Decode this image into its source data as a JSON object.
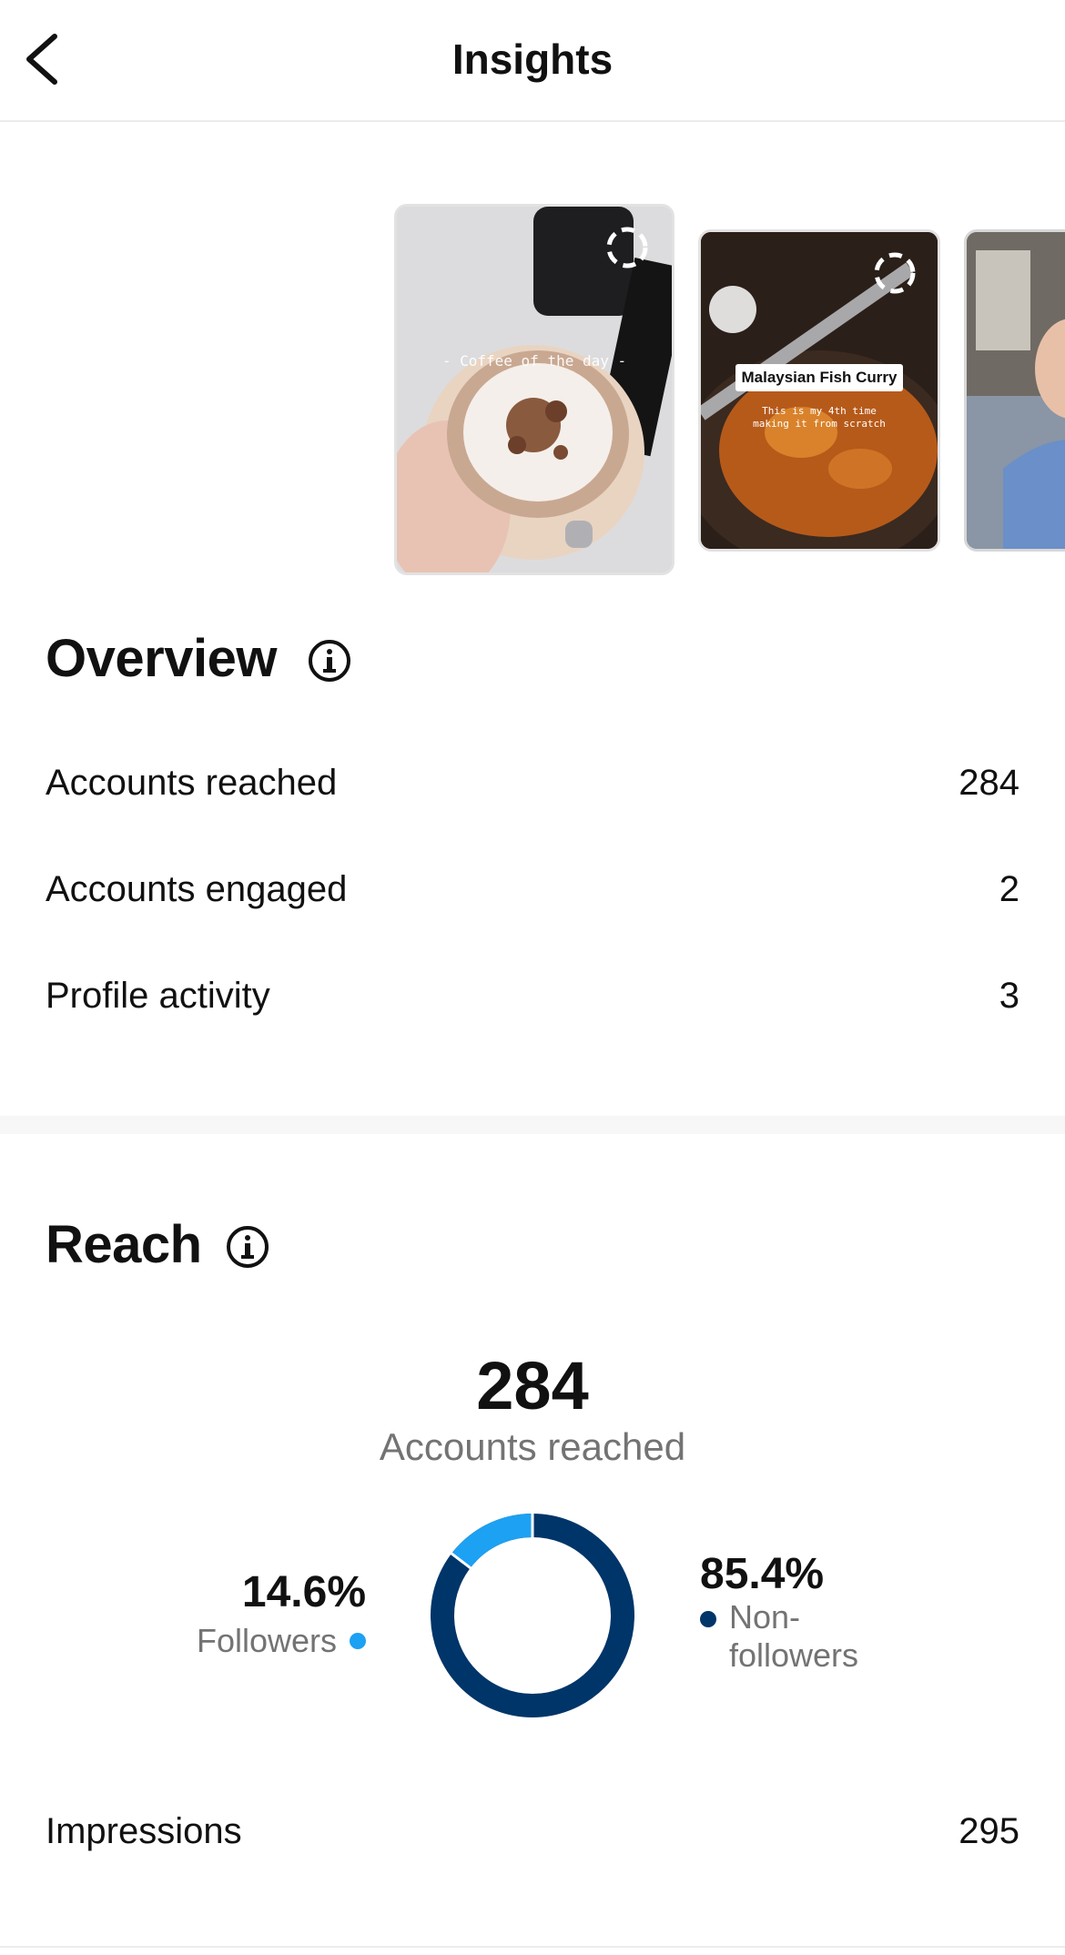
{
  "header": {
    "title": "Insights",
    "back_icon": "chevron-left-icon"
  },
  "stories": [
    {
      "caption": "- Coffee of the day -",
      "loader_icon": "dashed-circle-icon"
    },
    {
      "sticker": "Malaysian Fish Curry",
      "caption": "This is my 4th time\nmaking it from scratch",
      "loader_icon": "dashed-circle-icon"
    },
    {
      "caption": ""
    }
  ],
  "overview": {
    "title": "Overview",
    "info_icon": "info-icon",
    "rows": [
      {
        "label": "Accounts reached",
        "value": "284"
      },
      {
        "label": "Accounts engaged",
        "value": "2"
      },
      {
        "label": "Profile activity",
        "value": "3"
      }
    ]
  },
  "reach": {
    "title": "Reach",
    "info_icon": "info-icon",
    "total": "284",
    "total_label": "Accounts reached",
    "followers": {
      "percent_text": "14.6%",
      "label": "Followers",
      "color": "#1da1f2",
      "value": 14.6
    },
    "non_followers": {
      "percent_text": "85.4%",
      "label": "Non-\nfollowers",
      "color": "#003569",
      "value": 85.4
    },
    "impressions": {
      "label": "Impressions",
      "value": "295"
    }
  }
}
